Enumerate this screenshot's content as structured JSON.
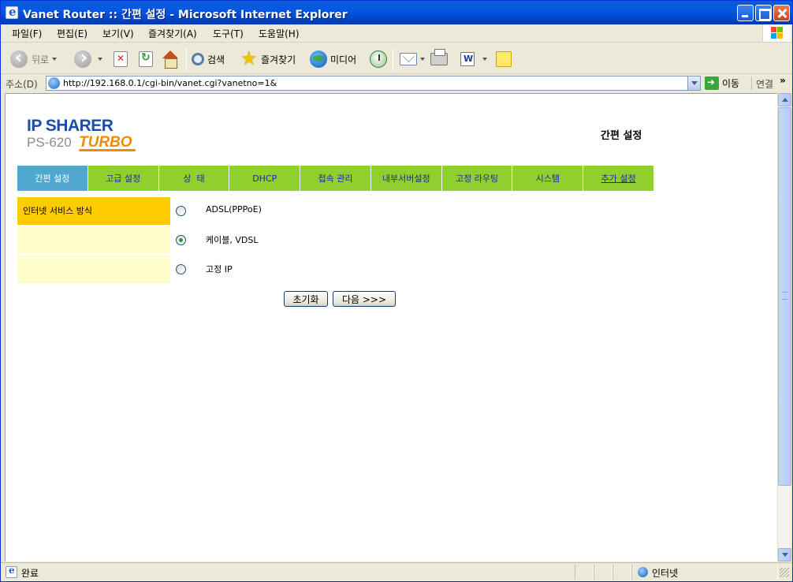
{
  "window": {
    "title": "Vanet Router :: 간편 설정 - Microsoft Internet Explorer"
  },
  "menu": {
    "items": [
      "파일(F)",
      "편집(E)",
      "보기(V)",
      "즐겨찾기(A)",
      "도구(T)",
      "도움말(H)"
    ]
  },
  "toolbar": {
    "back": "뒤로",
    "search": "검색",
    "favorites": "즐겨찾기",
    "media": "미디어"
  },
  "address": {
    "label": "주소(D)",
    "url": "http://192.168.0.1/cgi-bin/vanet.cgi?vanetno=1&",
    "go": "이동",
    "links": "연결",
    "more": "»"
  },
  "page": {
    "logo": {
      "line1": "IP SHARER",
      "line2": "PS-620",
      "turbo": "TURBO"
    },
    "title": "간편 설정",
    "tabs": [
      {
        "label": "간편 설정",
        "active": true
      },
      {
        "label": "고급 설정"
      },
      {
        "label": "상  태"
      },
      {
        "label": "DHCP"
      },
      {
        "label": "접속 관리"
      },
      {
        "label": "내부서버설정"
      },
      {
        "label": "고정 라우팅"
      },
      {
        "label": "시스템"
      },
      {
        "label": "추가 설정"
      }
    ],
    "section_label": "인터넷 서비스 방식",
    "options": [
      {
        "label": "ADSL(PPPoE)",
        "checked": false
      },
      {
        "label": "케이블, VDSL",
        "checked": true
      },
      {
        "label": "고정 IP",
        "checked": false
      }
    ],
    "reset_button": "초기화",
    "next_button": "다음 >>>"
  },
  "status": {
    "text": "완료",
    "zone": "인터넷"
  },
  "colors": {
    "tab_green": "#8fcf2e",
    "tab_active": "#4fa8d0",
    "section_yellow": "#ffcc00",
    "row_yellow": "#ffffcc",
    "logo_blue": "#1a4ea8",
    "logo_orange": "#f08a00"
  }
}
